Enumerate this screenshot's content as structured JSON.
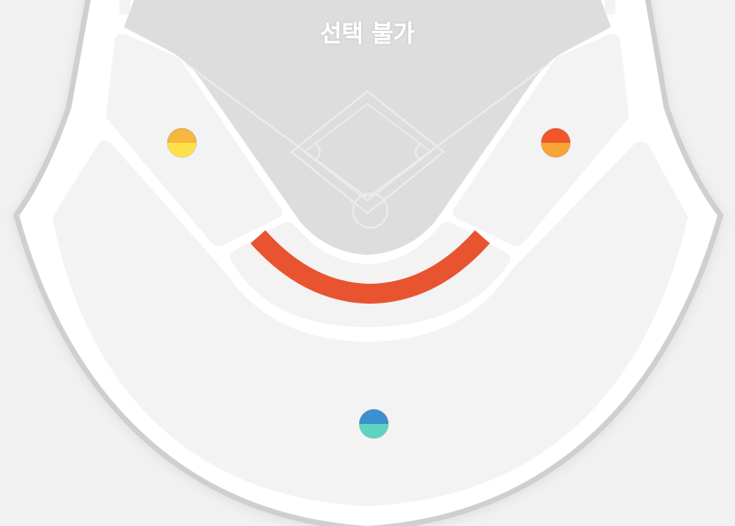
{
  "field": {
    "unavailable_label": "선택 불가"
  },
  "colors": {
    "page_bg": "#f1f1f1",
    "stadium_outline": "#cfcfcf",
    "concourse": "#ffffff",
    "section_fill": "#f3f3f3",
    "field_fill": "#dddddd",
    "field_lines": "#eeeeee",
    "highlight_arc": "#e85430"
  },
  "zones": [
    {
      "name": "left-upper-zone",
      "colors": [
        "#f6b73c",
        "#fde94e"
      ]
    },
    {
      "name": "right-upper-zone",
      "colors": [
        "#f2562a",
        "#f9b33a"
      ]
    },
    {
      "name": "outfield-zone",
      "colors": [
        "#3c8fd0",
        "#63e0c0"
      ]
    }
  ]
}
